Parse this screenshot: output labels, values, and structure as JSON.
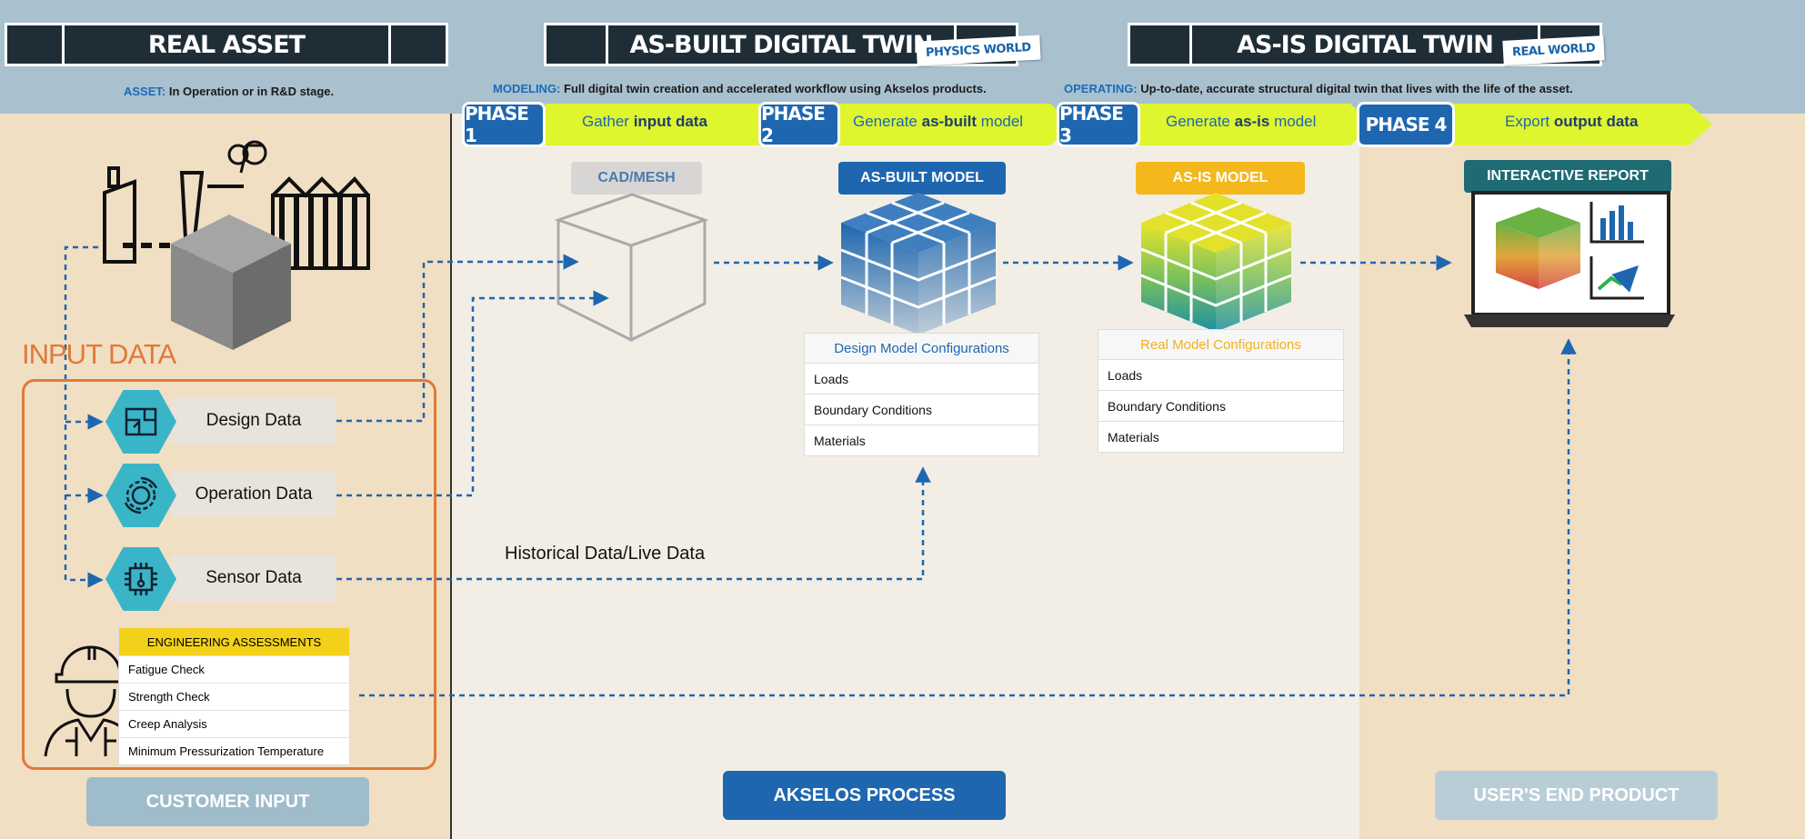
{
  "colors": {
    "phase_blue": "#1e67b0",
    "arrow_lime": "#dff52d",
    "orange": "#e07a38",
    "teal": "#3ab5c7",
    "dash_blue": "#1e67b0",
    "yellow": "#f3d11a",
    "asis_yellow": "#f4b81c",
    "report_teal": "#1f6b74"
  },
  "headers": {
    "real_asset": "REAL ASSET",
    "as_built": "AS-BUILT DIGITAL TWIN",
    "as_built_tag": "PHYSICS WORLD",
    "as_is": "AS-IS DIGITAL TWIN",
    "as_is_tag": "REAL WORLD"
  },
  "subheaders": {
    "asset_key": "ASSET:",
    "asset_text": " In Operation or in R&D stage.",
    "modeling_key": "MODELING:",
    "modeling_text": " Full digital twin creation and accelerated workflow using Akselos products.",
    "operating_key": "OPERATING:",
    "operating_text": " Up-to-date, accurate structural digital twin that lives with the life of the asset."
  },
  "phases": [
    {
      "label": "PHASE 1",
      "pre": "Gather ",
      "bold": "input data",
      "post": ""
    },
    {
      "label": "PHASE 2",
      "pre": "Generate ",
      "bold": "as-built",
      "post": " model"
    },
    {
      "label": "PHASE 3",
      "pre": "Generate ",
      "bold": "as-is",
      "post": " model"
    },
    {
      "label": "PHASE 4",
      "pre": "Export ",
      "bold": "output data",
      "post": ""
    }
  ],
  "models": {
    "cad": "CAD/MESH",
    "as_built": "AS-BUILT MODEL",
    "as_is": "AS-IS MODEL",
    "report": "INTERACTIVE REPORT"
  },
  "design_config": {
    "title": "Design Model Configurations",
    "rows": [
      "Loads",
      "Boundary Conditions",
      "Materials"
    ]
  },
  "real_config": {
    "title": "Real Model Configurations",
    "rows": [
      "Loads",
      "Boundary Conditions",
      "Materials"
    ]
  },
  "input": {
    "title": "INPUT DATA",
    "design": "Design Data",
    "operation": "Operation Data",
    "sensor": "Sensor Data"
  },
  "historical": "Historical Data/Live Data",
  "assessments": {
    "title": "ENGINEERING ASSESSMENTS",
    "rows": [
      "Fatigue Check",
      "Strength Check",
      "Creep Analysis",
      "Minimum Pressurization Temperature"
    ]
  },
  "bottom": {
    "customer": "CUSTOMER INPUT",
    "process": "AKSELOS PROCESS",
    "product": "USER'S END PRODUCT"
  }
}
